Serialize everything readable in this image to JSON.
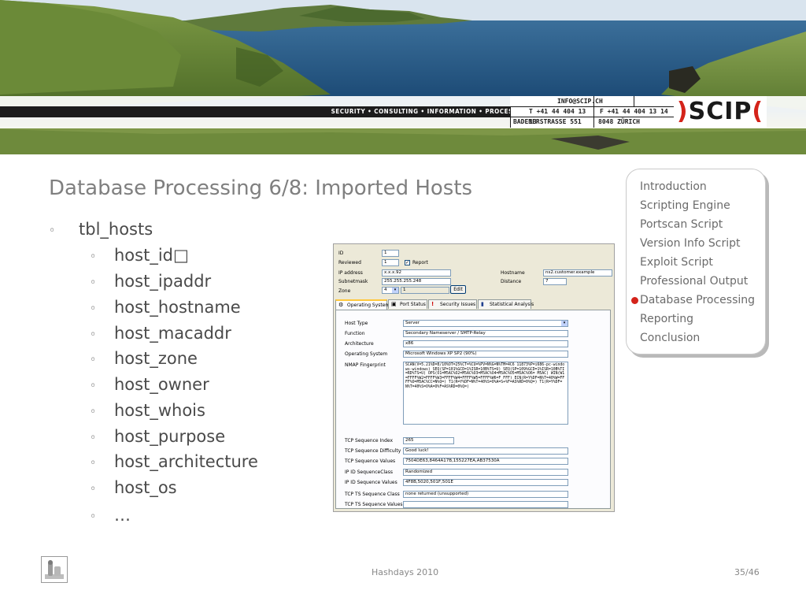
{
  "header": {
    "tagline": "SECURITY • CONSULTING • INFORMATION • PROCESS",
    "email": "INFO@SCIP.CH",
    "phone": "T +41 44 404 13 13",
    "fax": "F +41 44 404 13 14",
    "street": "BADENERSTRASSE 551",
    "city": "8048 ZÜRICH",
    "logo_left": ")",
    "logo_word": "SCIP",
    "logo_right": "("
  },
  "slide": {
    "title": "Database Processing 6/8: Imported Hosts",
    "bullet_marker": "◦",
    "top_bullet": "tbl_hosts",
    "sub_bullets": [
      "host_id□",
      "host_ipaddr",
      "host_hostname",
      "host_macaddr",
      "host_zone",
      "host_owner",
      "host_whois",
      "host_purpose",
      "host_architecture",
      "host_os",
      "…"
    ]
  },
  "form": {
    "labels": {
      "id": "ID",
      "reviewed": "Reviewed",
      "report": "Report",
      "ip_address": "IP address",
      "subnetmask": "Subnetmask",
      "zone": "Zone",
      "hostname": "Hostname",
      "distance": "Distance",
      "edit": "Edit"
    },
    "values": {
      "id": "1",
      "reviewed": "1",
      "report_checked": "✓",
      "ip_address": "x.x.x.92",
      "subnetmask": "255.255.255.248",
      "zone": "4",
      "zone_extra": "1",
      "hostname": "ns2.customer.example",
      "distance": "7"
    },
    "tabs": [
      {
        "label": "Operating System",
        "icon": "os-icon"
      },
      {
        "label": "Port Status",
        "icon": "port-icon"
      },
      {
        "label": "Security Issues",
        "icon": "warning-icon"
      },
      {
        "label": "Statistical Analysis",
        "icon": "chart-icon"
      }
    ],
    "os_fields": {
      "host_type_label": "Host Type",
      "host_type": "Server",
      "function_label": "Function",
      "function": "Secondary Nameserver / SMTP-Relay",
      "architecture_label": "Architecture",
      "architecture": "x86",
      "operating_system_label": "Operating System",
      "operating_system": "Microsoft Windows XP SP2 (90%)",
      "nmap_label": "NMAP Fingerprint",
      "nmap": "SCAN(V=5.21%D=8/10%OT=25%CT=%CU=%PV=N%G=N%TM=4C6 11873%P=i686-pc-windows-windows) SEQ(SP=101%GCD=1%ISR=10B%TS=U) SEQ(SP=109%GCD=1%ISR=10B%TI=RD%TS=U) OPS(O1=M5AC%O2=M5AC%O3=M5AC%O4=M5AC%O5=M5AC%O6= M5AC) WIN(W1=FFFF%W2=FFFF%W3=FFFF%W4=FFFF%W5=FFFF%W6=F FFF) ECN(R=Y%DF=N%T=40%W=FFFF%O=M5AC%CC=N%Q=) T1(R=Y%DF=N%T=40%S=O%A=S+%F=AS%RD=0%Q=) T1(R=Y%DF=N%T=40%S=O%A=O%F=AS%RD=0%Q=)",
      "tcp_index_label": "TCP Sequence Index",
      "tcp_index": "265",
      "tcp_difficulty_label": "TCP Sequence Difficulty",
      "tcp_difficulty": "Good luck!",
      "tcp_values_label": "TCP Sequence Values",
      "tcp_values": "7504DE63,8464A17B,155227EA,AB37530A",
      "ipid_class_label": "IP ID SequenceClass",
      "ipid_class": "Randomized",
      "ipid_values_label": "IP ID Sequence Values",
      "ipid_values": "4F8B,5020,501F,501E",
      "ts_class_label": "TCP TS Sequence Class",
      "ts_class": "none returned (unsupported)",
      "ts_values_label": "TCP TS Sequence Values",
      "ts_values": ""
    }
  },
  "nav": {
    "items": [
      "Introduction",
      "Scripting Engine",
      "Portscan Script",
      "Version Info Script",
      "Exploit Script",
      "Professional Output",
      "Database Processing",
      "Reporting",
      "Conclusion"
    ],
    "active_index": 6,
    "active_color": "#d4231a"
  },
  "footer": {
    "event": "Hashdays 2010",
    "page": "35/46"
  }
}
